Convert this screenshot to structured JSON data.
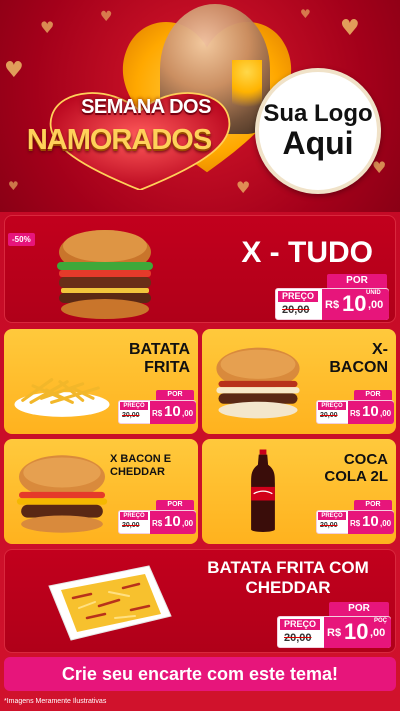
{
  "header": {
    "title_line1": "SEMANA DOS",
    "title_line2": "NAMORADOS",
    "logo_line1": "Sua Logo",
    "logo_line2": "Aqui"
  },
  "badge": "-50%",
  "products": [
    {
      "name": "X - TUDO",
      "price_label": "PREÇO",
      "old_price": "20,00",
      "por": "POR",
      "currency": "R$",
      "int": "10",
      "dec": ",00",
      "unit": "UNID"
    },
    {
      "name": "BATATA FRITA",
      "price_label": "PREÇO",
      "old_price": "20,00",
      "por": "POR",
      "currency": "R$",
      "int": "10",
      "dec": ",00",
      "unit": ""
    },
    {
      "name": "X- BACON",
      "price_label": "PREÇO",
      "old_price": "20,00",
      "por": "POR",
      "currency": "R$",
      "int": "10",
      "dec": ",00",
      "unit": ""
    },
    {
      "name": "X BACON E CHEDDAR",
      "price_label": "PREÇO",
      "old_price": "20,00",
      "por": "POR",
      "currency": "R$",
      "int": "10",
      "dec": ",00",
      "unit": ""
    },
    {
      "name": "COCA COLA 2L",
      "price_label": "PREÇO",
      "old_price": "20,00",
      "por": "POR",
      "currency": "R$",
      "int": "10",
      "dec": ",00",
      "unit": ""
    },
    {
      "name": "BATATA FRITA COM CHEDDAR",
      "price_label": "PREÇO",
      "old_price": "20,00",
      "por": "POR",
      "currency": "R$",
      "int": "10",
      "dec": ",00",
      "unit": "POÇ"
    }
  ],
  "cta": "Crie seu encarte com este tema!",
  "footnote": "*Imagens Meramente Ilustrativas",
  "colors": {
    "red": "#c2001d",
    "yellow": "#ffb21e",
    "pink": "#e7157b",
    "gold": "#ffd15a"
  }
}
